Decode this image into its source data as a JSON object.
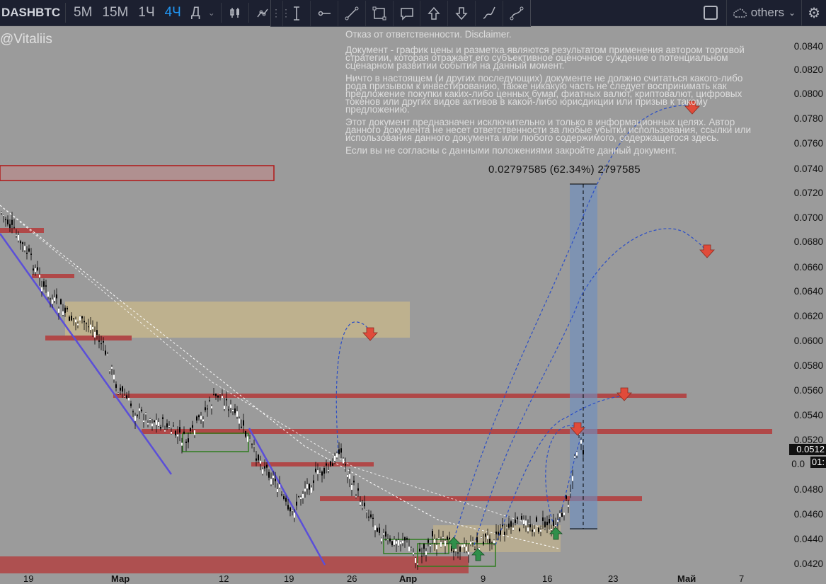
{
  "toolbar": {
    "symbol": "DASHBTC",
    "timeframes": [
      {
        "label": "5M",
        "active": false
      },
      {
        "label": "15M",
        "active": false
      },
      {
        "label": "1Ч",
        "active": false
      },
      {
        "label": "4Ч",
        "active": true
      },
      {
        "label": "Д",
        "active": false
      }
    ],
    "layout_name": "others"
  },
  "watermark": "@Vitaliis",
  "disclaimer": {
    "title": "Отказ от ответственности. Disclaimer.",
    "paragraphs": [
      "Документ - график цены и разметка являются результатом применения автором торговой стратегии, которая отражает его субъективное оценочное суждение о потенциальном сценарном развитии событий на данный момент.",
      "Ничто в настоящем (и других последующих) документе не должно считаться какого-либо рода призывом к инвестированию, также никакую часть не следует воспринимать как предложение покупки каких-либо ценных бумаг, фиатных валют, криптовалют, цифровых токенов или других видов активов в какой-либо юрисдикции или призыв к такому предложению.",
      "Этот документ предназначен исключительно и только в информационных целях. Автор данного документа не несет ответственности за любые убытки использования, ссылки или использования данного документа или любого содержимого, содержащегося здесь.",
      "Если вы не согласны с данными положениями закройте данный документ."
    ]
  },
  "measure_label": "0.02797585 (62.34%) 2797585",
  "price_axis": {
    "labels": [
      "0.0840",
      "0.0820",
      "0.0800",
      "0.0780",
      "0.0760",
      "0.0740",
      "0.0720",
      "0.0700",
      "0.0680",
      "0.0660",
      "0.0640",
      "0.0620",
      "0.0600",
      "0.0580",
      "0.0560",
      "0.0540",
      "0.0520",
      "0.0480",
      "0.0460",
      "0.0440",
      "0.0420"
    ],
    "current_price": "0.0512",
    "current_sub": "01:",
    "partial_label": "0.0"
  },
  "time_axis": {
    "labels": [
      "19",
      "Мар",
      "12",
      "19",
      "26",
      "Апр",
      "9",
      "16",
      "23",
      "Май",
      "7"
    ]
  },
  "colors": {
    "background": "#9b9b9b",
    "toolbar": "#1c2030",
    "active_timeframe": "#2196f3",
    "resistance_zone": "#b04848",
    "supply_zone": "#c9b88a",
    "support_box": "#2e7d1e",
    "trendline": "#5b4fd8",
    "forecast_line": "#2c4fc6",
    "measure_box": "#6e8fbf"
  }
}
